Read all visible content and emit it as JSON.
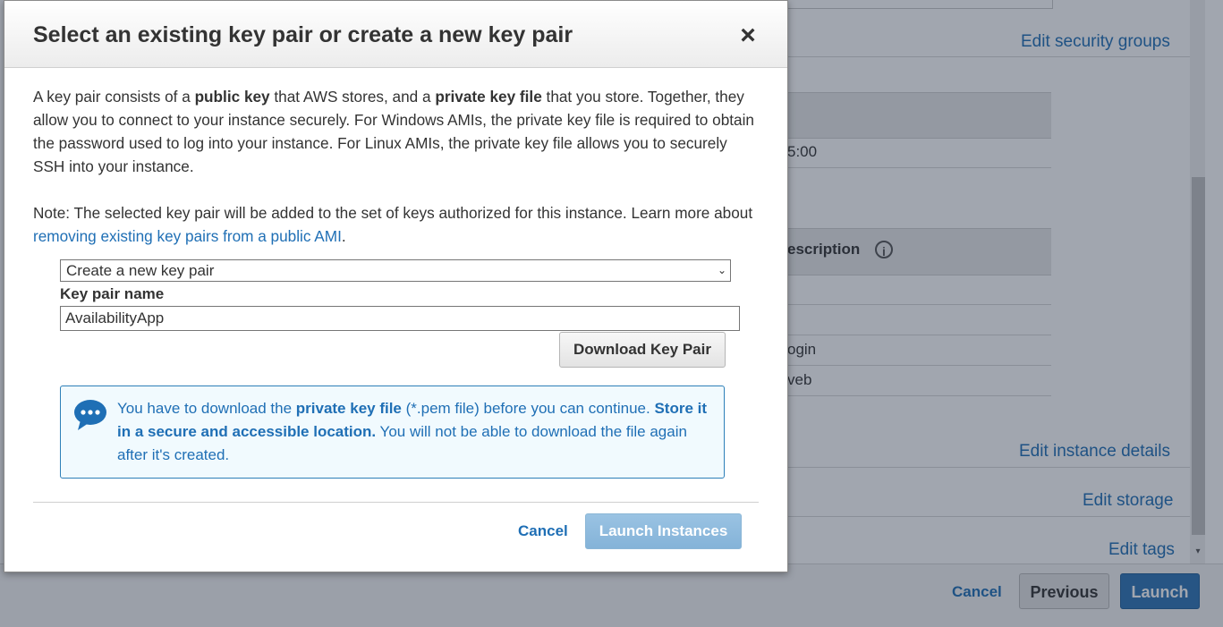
{
  "background": {
    "links": {
      "edit_security_groups": "Edit security groups",
      "edit_instance_details": "Edit instance details",
      "edit_storage": "Edit storage",
      "edit_tags": "Edit tags"
    },
    "partial_texts": {
      "time_fragment": "5:00",
      "description_header": "escription",
      "row_login": "ogin",
      "row_web": "veb"
    },
    "footer": {
      "cancel": "Cancel",
      "previous": "Previous",
      "launch": "Launch"
    }
  },
  "modal": {
    "title": "Select an existing key pair or create a new key pair",
    "close_icon": "×",
    "intro": {
      "t1": "A key pair consists of a ",
      "b1": "public key",
      "t2": " that AWS stores, and a ",
      "b2": "private key file",
      "t3": " that you store. Together, they allow you to connect to your instance securely. For Windows AMIs, the private key file is required to obtain the password used to log into your instance. For Linux AMIs, the private key file allows you to securely SSH into your instance."
    },
    "note": {
      "text": "Note: The selected key pair will be added to the set of keys authorized for this instance. Learn more about ",
      "link": "removing existing key pairs from a public AMI",
      "end": "."
    },
    "key_pair_select": {
      "selected": "Create a new key pair"
    },
    "key_pair_name": {
      "label": "Key pair name",
      "value": "AvailabilityApp"
    },
    "download_button": "Download Key Pair",
    "info": {
      "t1": "You have to download the ",
      "b1": "private key file",
      "t2": " (*.pem file) before you can continue. ",
      "b2": "Store it in a secure and accessible location.",
      "t3": " You will not be able to download the file again after it's created."
    },
    "cancel": "Cancel",
    "launch_instances": "Launch Instances"
  },
  "colors": {
    "link": "#1f6fb5",
    "primary_button": "#2e74b5",
    "info_border": "#2d7fb8",
    "info_bg": "#f1fafe"
  }
}
